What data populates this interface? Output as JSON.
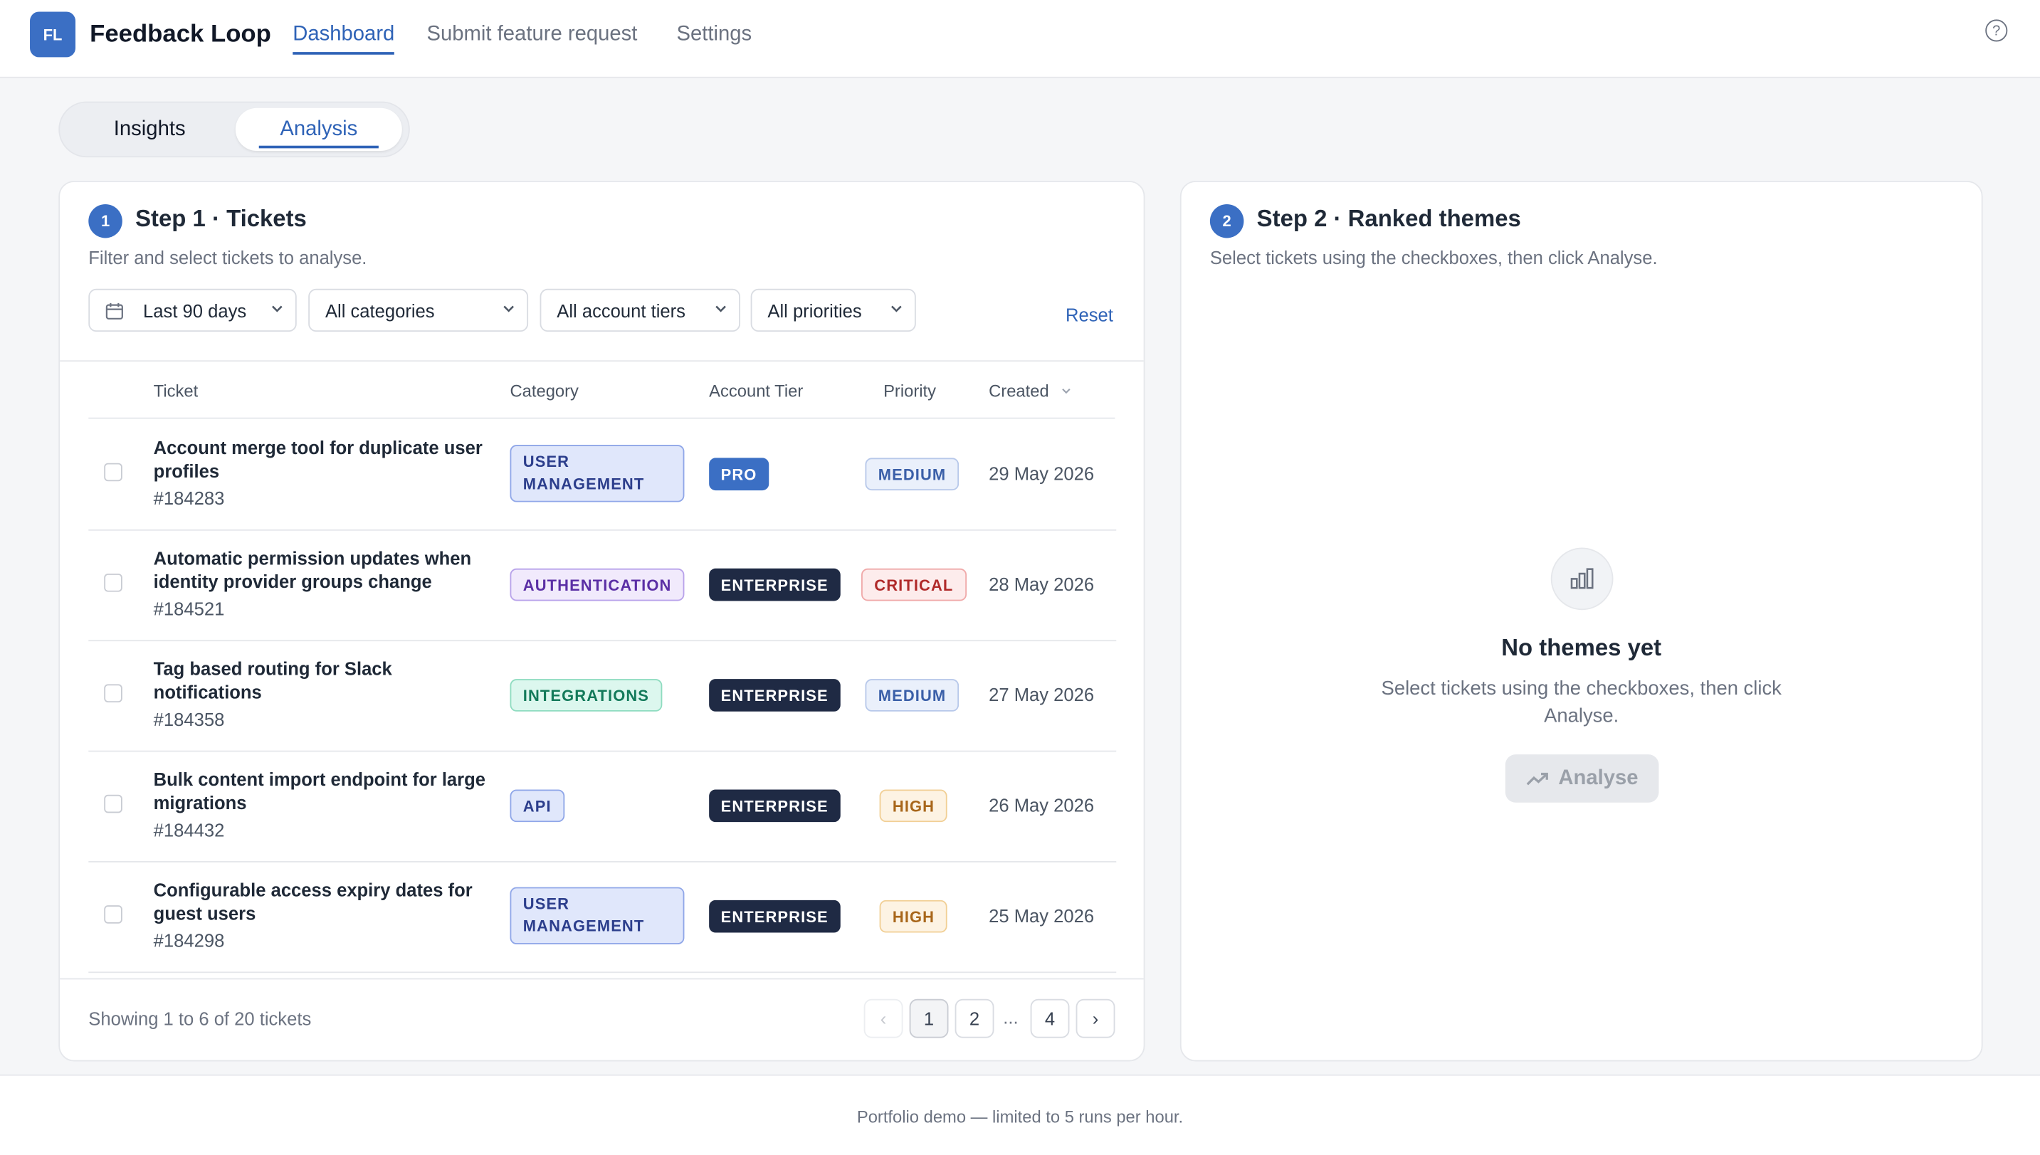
{
  "header": {
    "logo_text": "FL",
    "app_name": "Feedback Loop",
    "nav": [
      {
        "label": "Dashboard",
        "active": true
      },
      {
        "label": "Submit feature request",
        "active": false
      },
      {
        "label": "Settings",
        "active": false
      }
    ],
    "help_icon": "help-circle-icon"
  },
  "view_tabs": [
    {
      "label": "Insights",
      "active": false
    },
    {
      "label": "Analysis",
      "active": true
    }
  ],
  "step1": {
    "number": "1",
    "title": "Step 1 · Tickets",
    "subtitle": "Filter and select tickets to analyse.",
    "filters": {
      "date": "Last 90 days",
      "category": "All categories",
      "tier": "All account tiers",
      "priority": "All priorities"
    },
    "reset_label": "Reset",
    "columns": {
      "ticket": "Ticket",
      "category": "Category",
      "tier": "Account Tier",
      "priority": "Priority",
      "created": "Created"
    },
    "tickets": [
      {
        "title": "Account merge tool for duplicate user profiles",
        "id": "#184283",
        "category": "USER MANAGEMENT",
        "tier": "PRO",
        "priority": "MEDIUM",
        "created": "29 May 2026"
      },
      {
        "title": "Automatic permission updates when identity provider groups change",
        "id": "#184521",
        "category": "AUTHENTICATION",
        "tier": "ENTERPRISE",
        "priority": "CRITICAL",
        "created": "28 May 2026"
      },
      {
        "title": "Tag based routing for Slack notifications",
        "id": "#184358",
        "category": "INTEGRATIONS",
        "tier": "ENTERPRISE",
        "priority": "MEDIUM",
        "created": "27 May 2026"
      },
      {
        "title": "Bulk content import endpoint for large migrations",
        "id": "#184432",
        "category": "API",
        "tier": "ENTERPRISE",
        "priority": "HIGH",
        "created": "26 May 2026"
      },
      {
        "title": "Configurable access expiry dates for guest users",
        "id": "#184298",
        "category": "USER MANAGEMENT",
        "tier": "ENTERPRISE",
        "priority": "HIGH",
        "created": "25 May 2026"
      }
    ],
    "showing_text": "Showing 1 to 6 of 20 tickets",
    "pagination": {
      "prev": "‹",
      "pages": [
        "1",
        "2",
        "4"
      ],
      "ellipsis": "...",
      "next": "›",
      "current": "1"
    }
  },
  "step2": {
    "number": "2",
    "title": "Step 2 · Ranked themes",
    "subtitle": "Select tickets using the checkboxes, then click Analyse.",
    "empty_title": "No themes yet",
    "empty_subtitle": "Select tickets using the checkboxes, then click Analyse.",
    "analyse_label": "Analyse"
  },
  "footer": {
    "text": "Portfolio demo — limited to 5 runs per hour."
  },
  "colors": {
    "accent": "#3b6fc4",
    "link": "#2f63b7",
    "enterprise": "#1f2a44"
  }
}
